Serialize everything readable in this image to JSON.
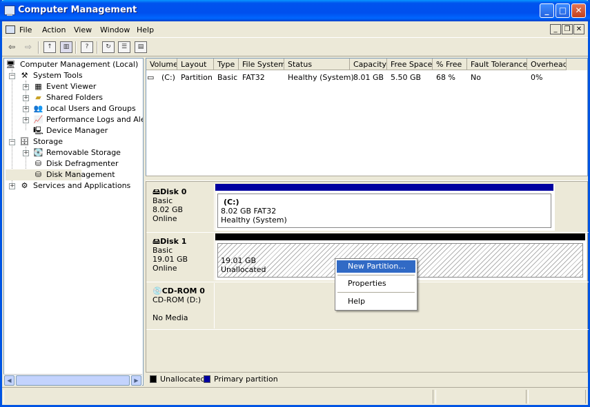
{
  "window": {
    "title": "Computer Management",
    "controls": [
      "_",
      "□",
      "✕"
    ]
  },
  "menubar": {
    "items": [
      "File",
      "Action",
      "View",
      "Window",
      "Help"
    ],
    "mdi_controls": [
      "_",
      "❐",
      "✕"
    ]
  },
  "toolbar": {
    "buttons": [
      "back-icon",
      "forward-icon",
      "up-folder-icon",
      "show-hide-tree-icon",
      "help-icon",
      "refresh-icon",
      "properties-icon",
      "help-topics-icon"
    ]
  },
  "tree": {
    "root": "Computer Management (Local)",
    "system_tools": "System Tools",
    "event_viewer": "Event Viewer",
    "shared_folders": "Shared Folders",
    "local_users": "Local Users and Groups",
    "perf_logs": "Performance Logs and Alerts",
    "device_manager": "Device Manager",
    "storage": "Storage",
    "removable_storage": "Removable Storage",
    "disk_defrag": "Disk Defragmenter",
    "disk_management": "Disk Management",
    "services_apps": "Services and Applications"
  },
  "volume_list": {
    "columns": [
      "Volume",
      "Layout",
      "Type",
      "File System",
      "Status",
      "Capacity",
      "Free Space",
      "% Free",
      "Fault Tolerance",
      "Overhead"
    ],
    "rows": [
      {
        "volume": "(C:)",
        "layout": "Partition",
        "type": "Basic",
        "fs": "FAT32",
        "status": "Healthy (System)",
        "capacity": "8.01 GB",
        "free": "5.50 GB",
        "pct_free": "68 %",
        "fault": "No",
        "overhead": "0%"
      }
    ]
  },
  "disks": [
    {
      "name": "Disk 0",
      "type": "Basic",
      "size": "8.02 GB",
      "state": "Online",
      "partition": {
        "label": "(C:)",
        "detail": "8.02 GB FAT32",
        "status": "Healthy (System)",
        "color": "#0000a0"
      }
    },
    {
      "name": "Disk 1",
      "type": "Basic",
      "size": "19.01 GB",
      "state": "Online",
      "partition": {
        "detail": "19.01 GB",
        "status": "Unallocated",
        "color": "#000000"
      }
    },
    {
      "name": "CD-ROM 0",
      "type": "CD-ROM (D:)",
      "media": "No Media"
    }
  ],
  "legend": {
    "unallocated": "Unallocated",
    "unallocated_color": "#000000",
    "primary": "Primary partition",
    "primary_color": "#0000a0"
  },
  "context_menu": {
    "new_partition": "New Partition...",
    "properties": "Properties",
    "help": "Help"
  }
}
